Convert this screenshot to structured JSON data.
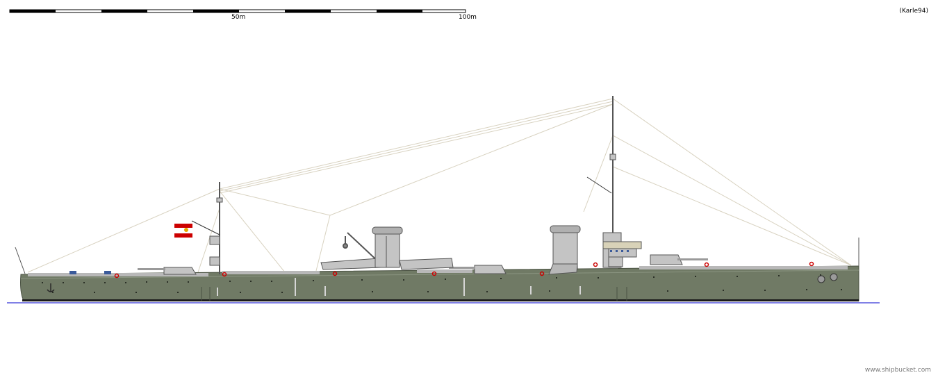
{
  "scale_bar": {
    "label_mid": "50m",
    "label_end": "100m"
  },
  "credit": "(Karle94)",
  "watermark": "www.shipbucket.com",
  "colors": {
    "hull": "#707a65",
    "superstructure": "#c4c4c4",
    "waterline": "#0000cc",
    "rigging": "#d8d2c0",
    "boot_top": "#1a1a1a"
  },
  "flag": {
    "colors": [
      "#cc0000",
      "#ffffff",
      "#cc0000"
    ],
    "emblem_color": "#e8a800"
  }
}
